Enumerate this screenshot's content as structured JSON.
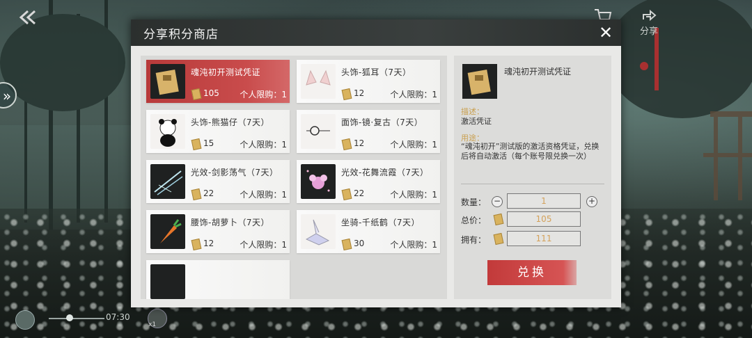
{
  "header": {
    "title": "分享积分商店",
    "close_label": "✕"
  },
  "top_right": {
    "share_label": "分享"
  },
  "bottom_bar": {
    "time": "07:30",
    "multiplier": "x1"
  },
  "items": [
    {
      "name": "魂沌初开测试凭证",
      "price": "105",
      "limit": "个人限购：1"
    },
    {
      "name": "头饰-狐耳（7天）",
      "price": "12",
      "limit": "个人限购：1"
    },
    {
      "name": "头饰-熊猫仔（7天）",
      "price": "15",
      "limit": "个人限购：1"
    },
    {
      "name": "面饰-镜·复古（7天）",
      "price": "12",
      "limit": "个人限购：1"
    },
    {
      "name": "光效-剑影荡气（7天）",
      "price": "22",
      "limit": "个人限购：1"
    },
    {
      "name": "光效-花舞流霞（7天）",
      "price": "22",
      "limit": "个人限购：1"
    },
    {
      "name": "腰饰-胡萝卜（7天）",
      "price": "12",
      "limit": "个人限购：1"
    },
    {
      "name": "坐骑-千纸鹤（7天）",
      "price": "30",
      "limit": "个人限购：1"
    }
  ],
  "detail": {
    "name": "魂沌初开测试凭证",
    "desc_label": "描述：",
    "desc_text": "激活凭证",
    "use_label": "用途：",
    "use_text": "“魂沌初开”测试版的激活资格凭证，兑换后将自动激活（每个账号限兑换一次）",
    "qty_label": "数量：",
    "qty_value": "1",
    "total_label": "总价：",
    "total_value": "105",
    "owned_label": "拥有：",
    "owned_value": "111",
    "exchange_label": "兑换"
  },
  "colors": {
    "selected": "#c94c4c",
    "accent_gold": "#d4a15a",
    "header_bg": "#2b2f2e"
  }
}
